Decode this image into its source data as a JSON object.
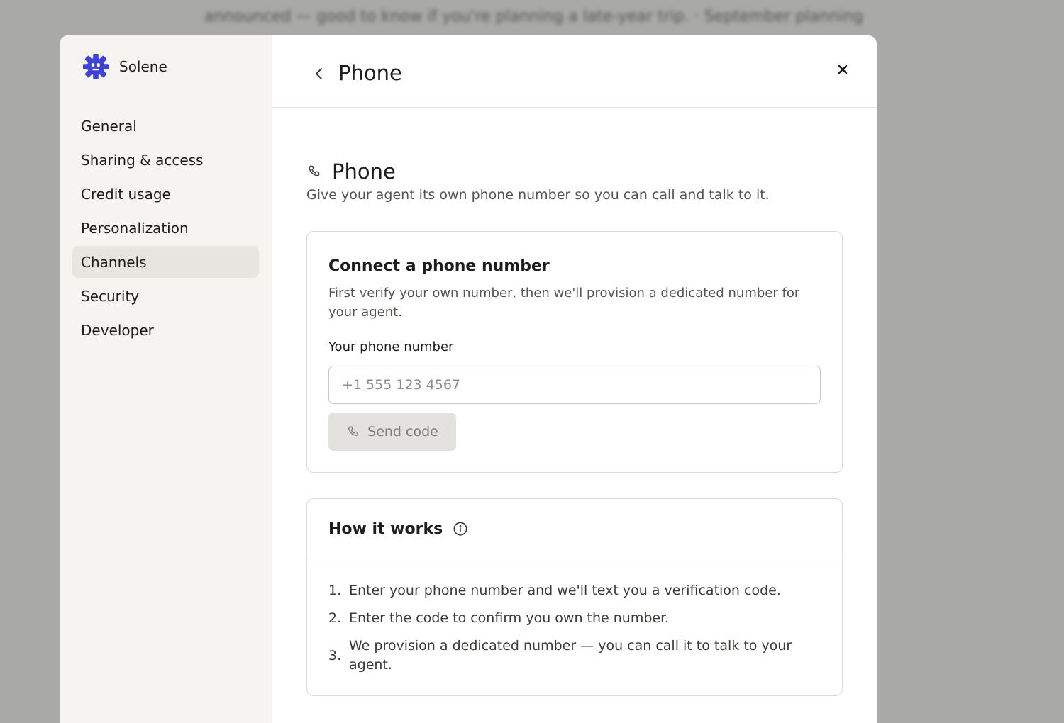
{
  "background": {
    "text": "announced — good to know if you're planning a late-year trip. · September planning"
  },
  "brand": {
    "name": "Solene",
    "logo_icon": "gear-robot-icon",
    "accent": "#3d42d8"
  },
  "sidebar": {
    "items": [
      {
        "label": "General",
        "active": false
      },
      {
        "label": "Sharing & access",
        "active": false
      },
      {
        "label": "Credit usage",
        "active": false
      },
      {
        "label": "Personalization",
        "active": false
      },
      {
        "label": "Channels",
        "active": true
      },
      {
        "label": "Security",
        "active": false
      },
      {
        "label": "Developer",
        "active": false
      }
    ]
  },
  "header": {
    "title": "Phone",
    "back_icon": "chevron-left-icon",
    "close_icon": "close-icon"
  },
  "section": {
    "icon": "phone-icon",
    "title": "Phone",
    "description": "Give your agent its own phone number so you can call and talk to it."
  },
  "connect_card": {
    "title": "Connect a phone number",
    "description": "First verify your own number, then we'll provision a dedicated number for your agent.",
    "field_label": "Your phone number",
    "input_value": "",
    "input_placeholder": "+1 555 123 4567",
    "send_button_label": "Send code",
    "send_button_icon": "phone-icon"
  },
  "how_card": {
    "title": "How it works",
    "info_icon": "info-icon",
    "steps": [
      {
        "num": "1.",
        "text": "Enter your phone number and we'll text you a verification code."
      },
      {
        "num": "2.",
        "text": "Enter the code to confirm you own the number."
      },
      {
        "num": "3.",
        "text": "We provision a dedicated number — you can call it to talk to your agent."
      }
    ]
  }
}
